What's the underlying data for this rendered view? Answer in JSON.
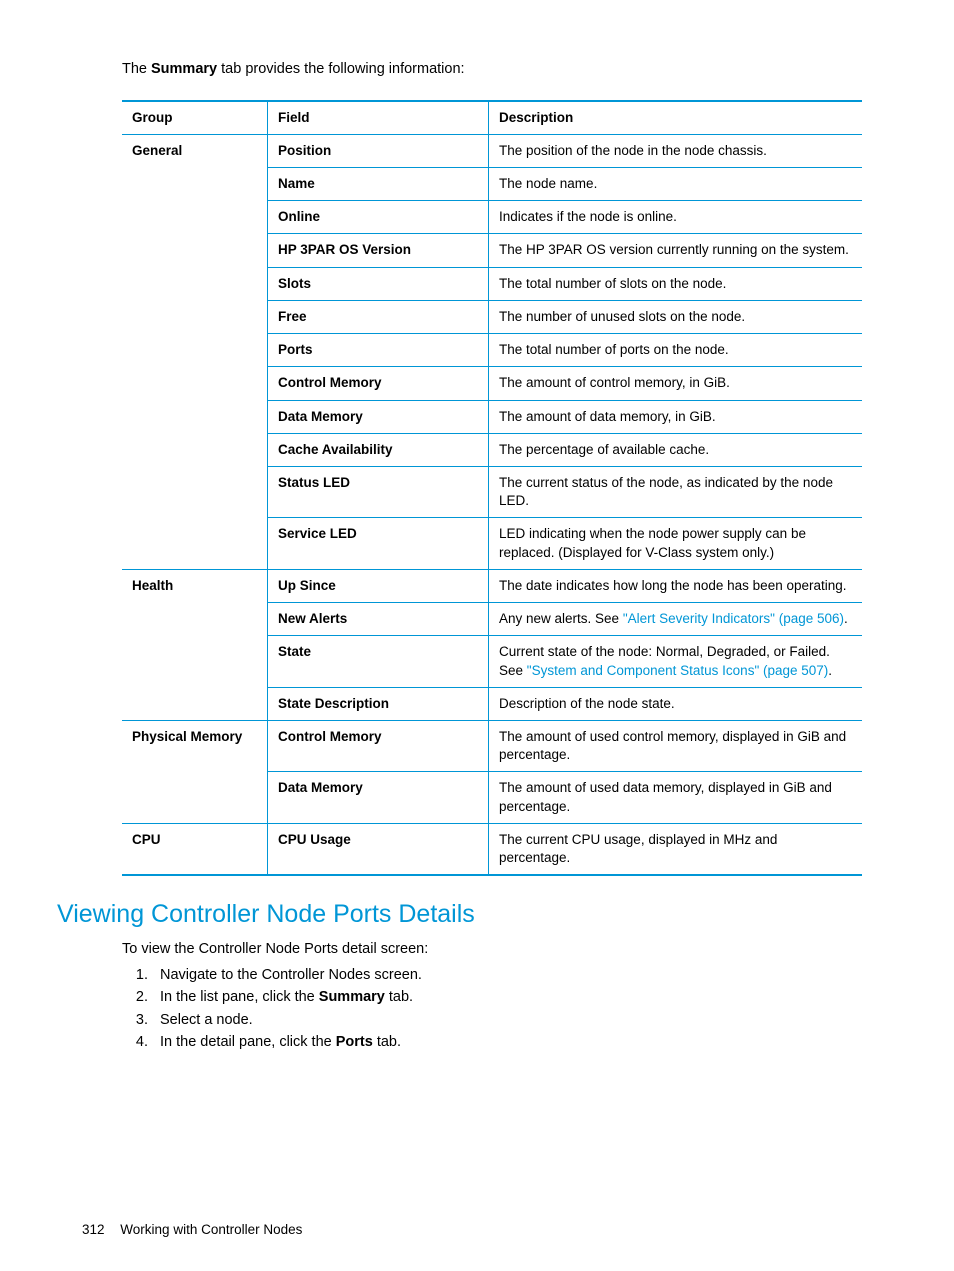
{
  "intro_pre": "The ",
  "intro_bold": "Summary",
  "intro_post": " tab provides the following information:",
  "headers": {
    "group": "Group",
    "field": "Field",
    "desc": "Description"
  },
  "rows": [
    {
      "group": "General",
      "field": "Position",
      "desc": "The position of the node in the node chassis.",
      "gclass": "group-start"
    },
    {
      "group": "",
      "field": "Name",
      "desc": "The node name.",
      "gclass": "group-cont"
    },
    {
      "group": "",
      "field": "Online",
      "desc": "Indicates if the node is online.",
      "gclass": "group-cont"
    },
    {
      "group": "",
      "field": "HP 3PAR OS Version",
      "desc": "The HP 3PAR OS version currently running on the system.",
      "gclass": "group-cont"
    },
    {
      "group": "",
      "field": "Slots",
      "desc": "The total number of slots on the node.",
      "gclass": "group-cont"
    },
    {
      "group": "",
      "field": "Free",
      "desc": "The number of unused slots on the node.",
      "gclass": "group-cont"
    },
    {
      "group": "",
      "field": "Ports",
      "desc": "The total number of ports on the node.",
      "gclass": "group-cont"
    },
    {
      "group": "",
      "field": "Control Memory",
      "desc": "The amount of control memory, in GiB.",
      "gclass": "group-cont"
    },
    {
      "group": "",
      "field": "Data Memory",
      "desc": "The amount of data memory, in GiB.",
      "gclass": "group-cont"
    },
    {
      "group": "",
      "field": "Cache Availability",
      "desc": "The percentage of available cache.",
      "gclass": "group-cont"
    },
    {
      "group": "",
      "field": "Status LED",
      "desc": "The current status of the node, as indicated by the node LED.",
      "gclass": "group-cont"
    },
    {
      "group": "",
      "field": "Service LED",
      "desc": "LED indicating when the node power supply can be replaced. (Displayed for V-Class system only.)",
      "gclass": "group-last"
    },
    {
      "group": "Health",
      "field": "Up Since",
      "desc": "The date indicates how long the node has been operating.",
      "gclass": "group-start"
    },
    {
      "group": "",
      "field": "New Alerts",
      "desc_pre": "Any new alerts. See ",
      "desc_link": "\"Alert Severity Indicators\" (page 506)",
      "desc_post": ".",
      "gclass": "group-cont"
    },
    {
      "group": "",
      "field": "State",
      "desc_pre": "Current state of the node: Normal, Degraded, or Failed. See ",
      "desc_link": "\"System and Component Status Icons\" (page 507)",
      "desc_post": ".",
      "gclass": "group-cont"
    },
    {
      "group": "",
      "field": "State Description",
      "desc": "Description of the node state.",
      "gclass": "group-last"
    },
    {
      "group": "Physical Memory",
      "field": "Control Memory",
      "desc": "The amount of used control memory, displayed in GiB and percentage.",
      "gclass": "group-start"
    },
    {
      "group": "",
      "field": "Data Memory",
      "desc": "The amount of used data memory, displayed in GiB and percentage.",
      "gclass": "group-last"
    },
    {
      "group": "CPU",
      "field": "CPU Usage",
      "desc": "The current CPU usage, displayed in MHz and percentage.",
      "gclass": "group-last last-row"
    }
  ],
  "section_heading": "Viewing Controller Node Ports Details",
  "section_intro": "To view the Controller Node Ports detail screen:",
  "steps": [
    {
      "parts": [
        {
          "t": "Navigate to the Controller Nodes screen."
        }
      ]
    },
    {
      "parts": [
        {
          "t": "In the list pane, click the "
        },
        {
          "b": "Summary"
        },
        {
          "t": " tab."
        }
      ]
    },
    {
      "parts": [
        {
          "t": "Select a node."
        }
      ]
    },
    {
      "parts": [
        {
          "t": "In the detail pane, click the "
        },
        {
          "b": "Ports"
        },
        {
          "t": " tab."
        }
      ]
    }
  ],
  "footer": {
    "page": "312",
    "title": "Working with Controller Nodes"
  }
}
